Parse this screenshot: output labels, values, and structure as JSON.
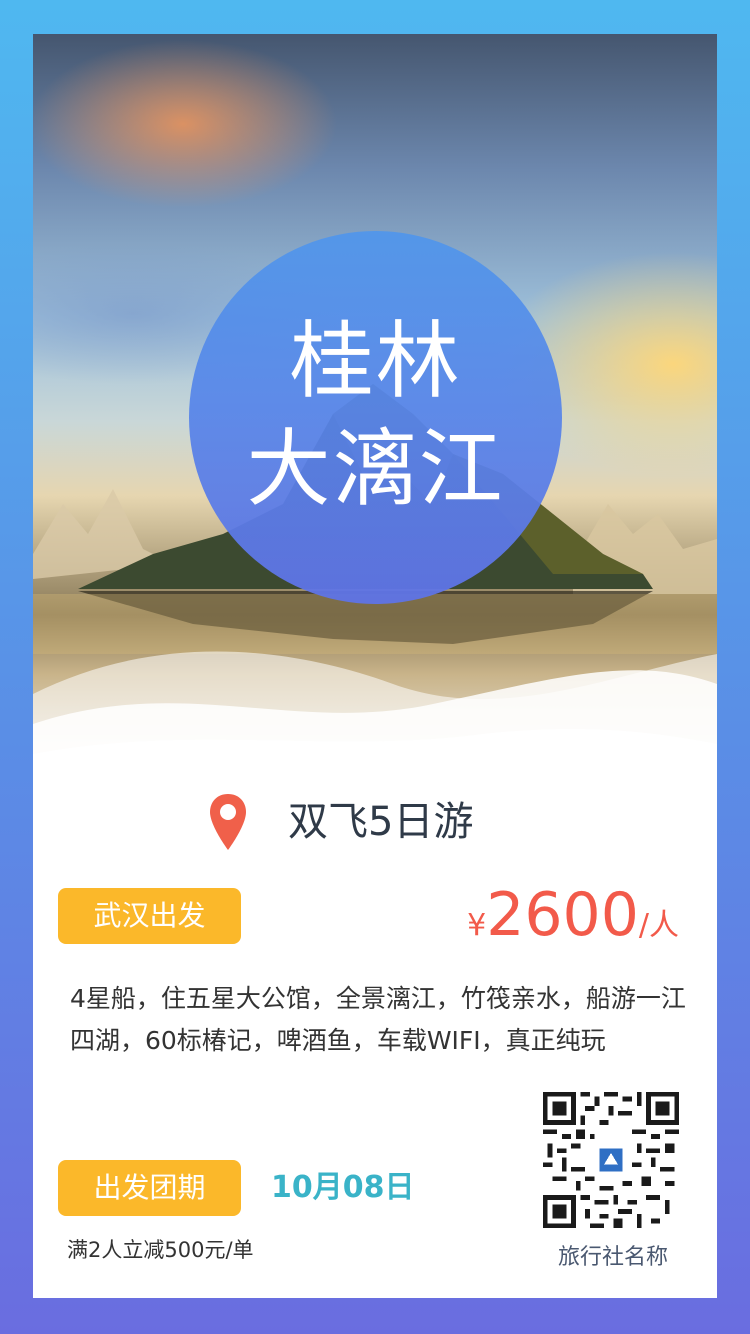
{
  "poster": {
    "title_line1": "桂林",
    "title_line2": "大漓江",
    "subtitle": "双飞5日游",
    "departure_label": "武汉出发",
    "price": {
      "currency": "¥",
      "amount": "2600",
      "unit": "/人"
    },
    "description": "4星船，住五星大公馆，全景漓江，竹筏亲水，船游一江四湖，60标椿记，啤酒鱼，车载WIFI，真正纯玩",
    "schedule_label": "出发团期",
    "schedule_date": "10月08日",
    "promo_note": "满2人立减500元/单",
    "agency_name": "旅行社名称"
  },
  "icons": [
    "location-pin-icon",
    "qr-code-icon"
  ],
  "colors": {
    "background_top": "#4fb8f0",
    "background_bottom": "#6a6de0",
    "pill": "#fbb82a",
    "price": "#f25a4a",
    "date": "#3ab3c8",
    "pin": "#f0604a",
    "circle": "#5f8ee8"
  }
}
